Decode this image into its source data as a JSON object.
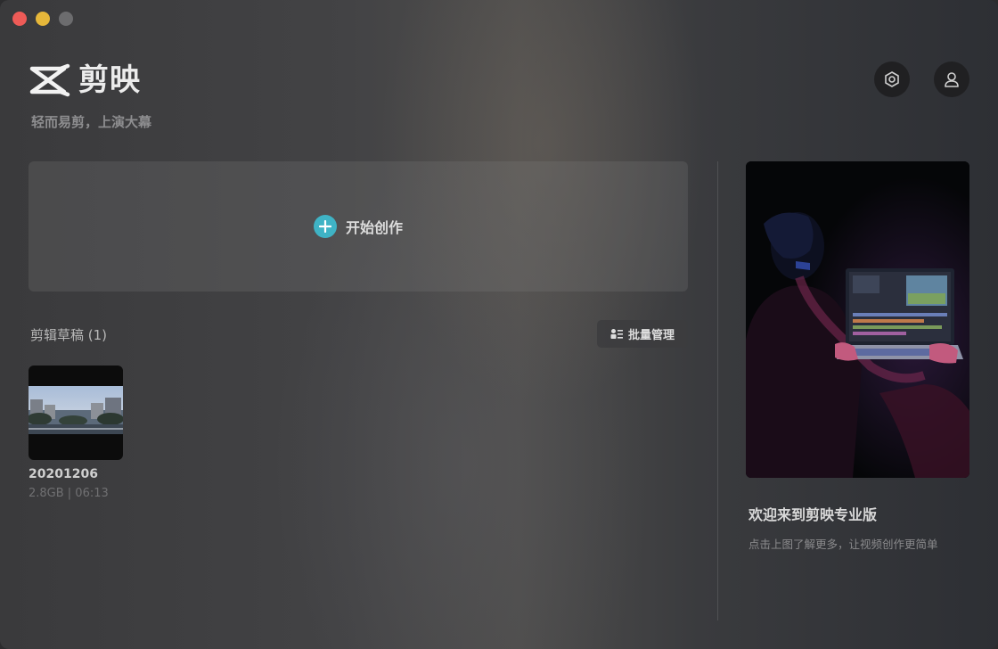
{
  "app": {
    "name": "剪映",
    "slogan": "轻而易剪，上演大幕"
  },
  "header": {
    "settings_icon": "settings-hex-icon",
    "user_icon": "user-icon"
  },
  "create": {
    "label": "开始创作",
    "icon": "plus-circle-icon",
    "accent": "#3fb3c5"
  },
  "drafts": {
    "title": "剪辑草稿 (1)",
    "batch_label": "批量管理",
    "items": [
      {
        "name": "20201206",
        "meta": "2.8GB | 06:13"
      }
    ]
  },
  "promo": {
    "title": "欢迎来到剪映专业版",
    "subtitle": "点击上图了解更多，让视频创作更简单"
  }
}
